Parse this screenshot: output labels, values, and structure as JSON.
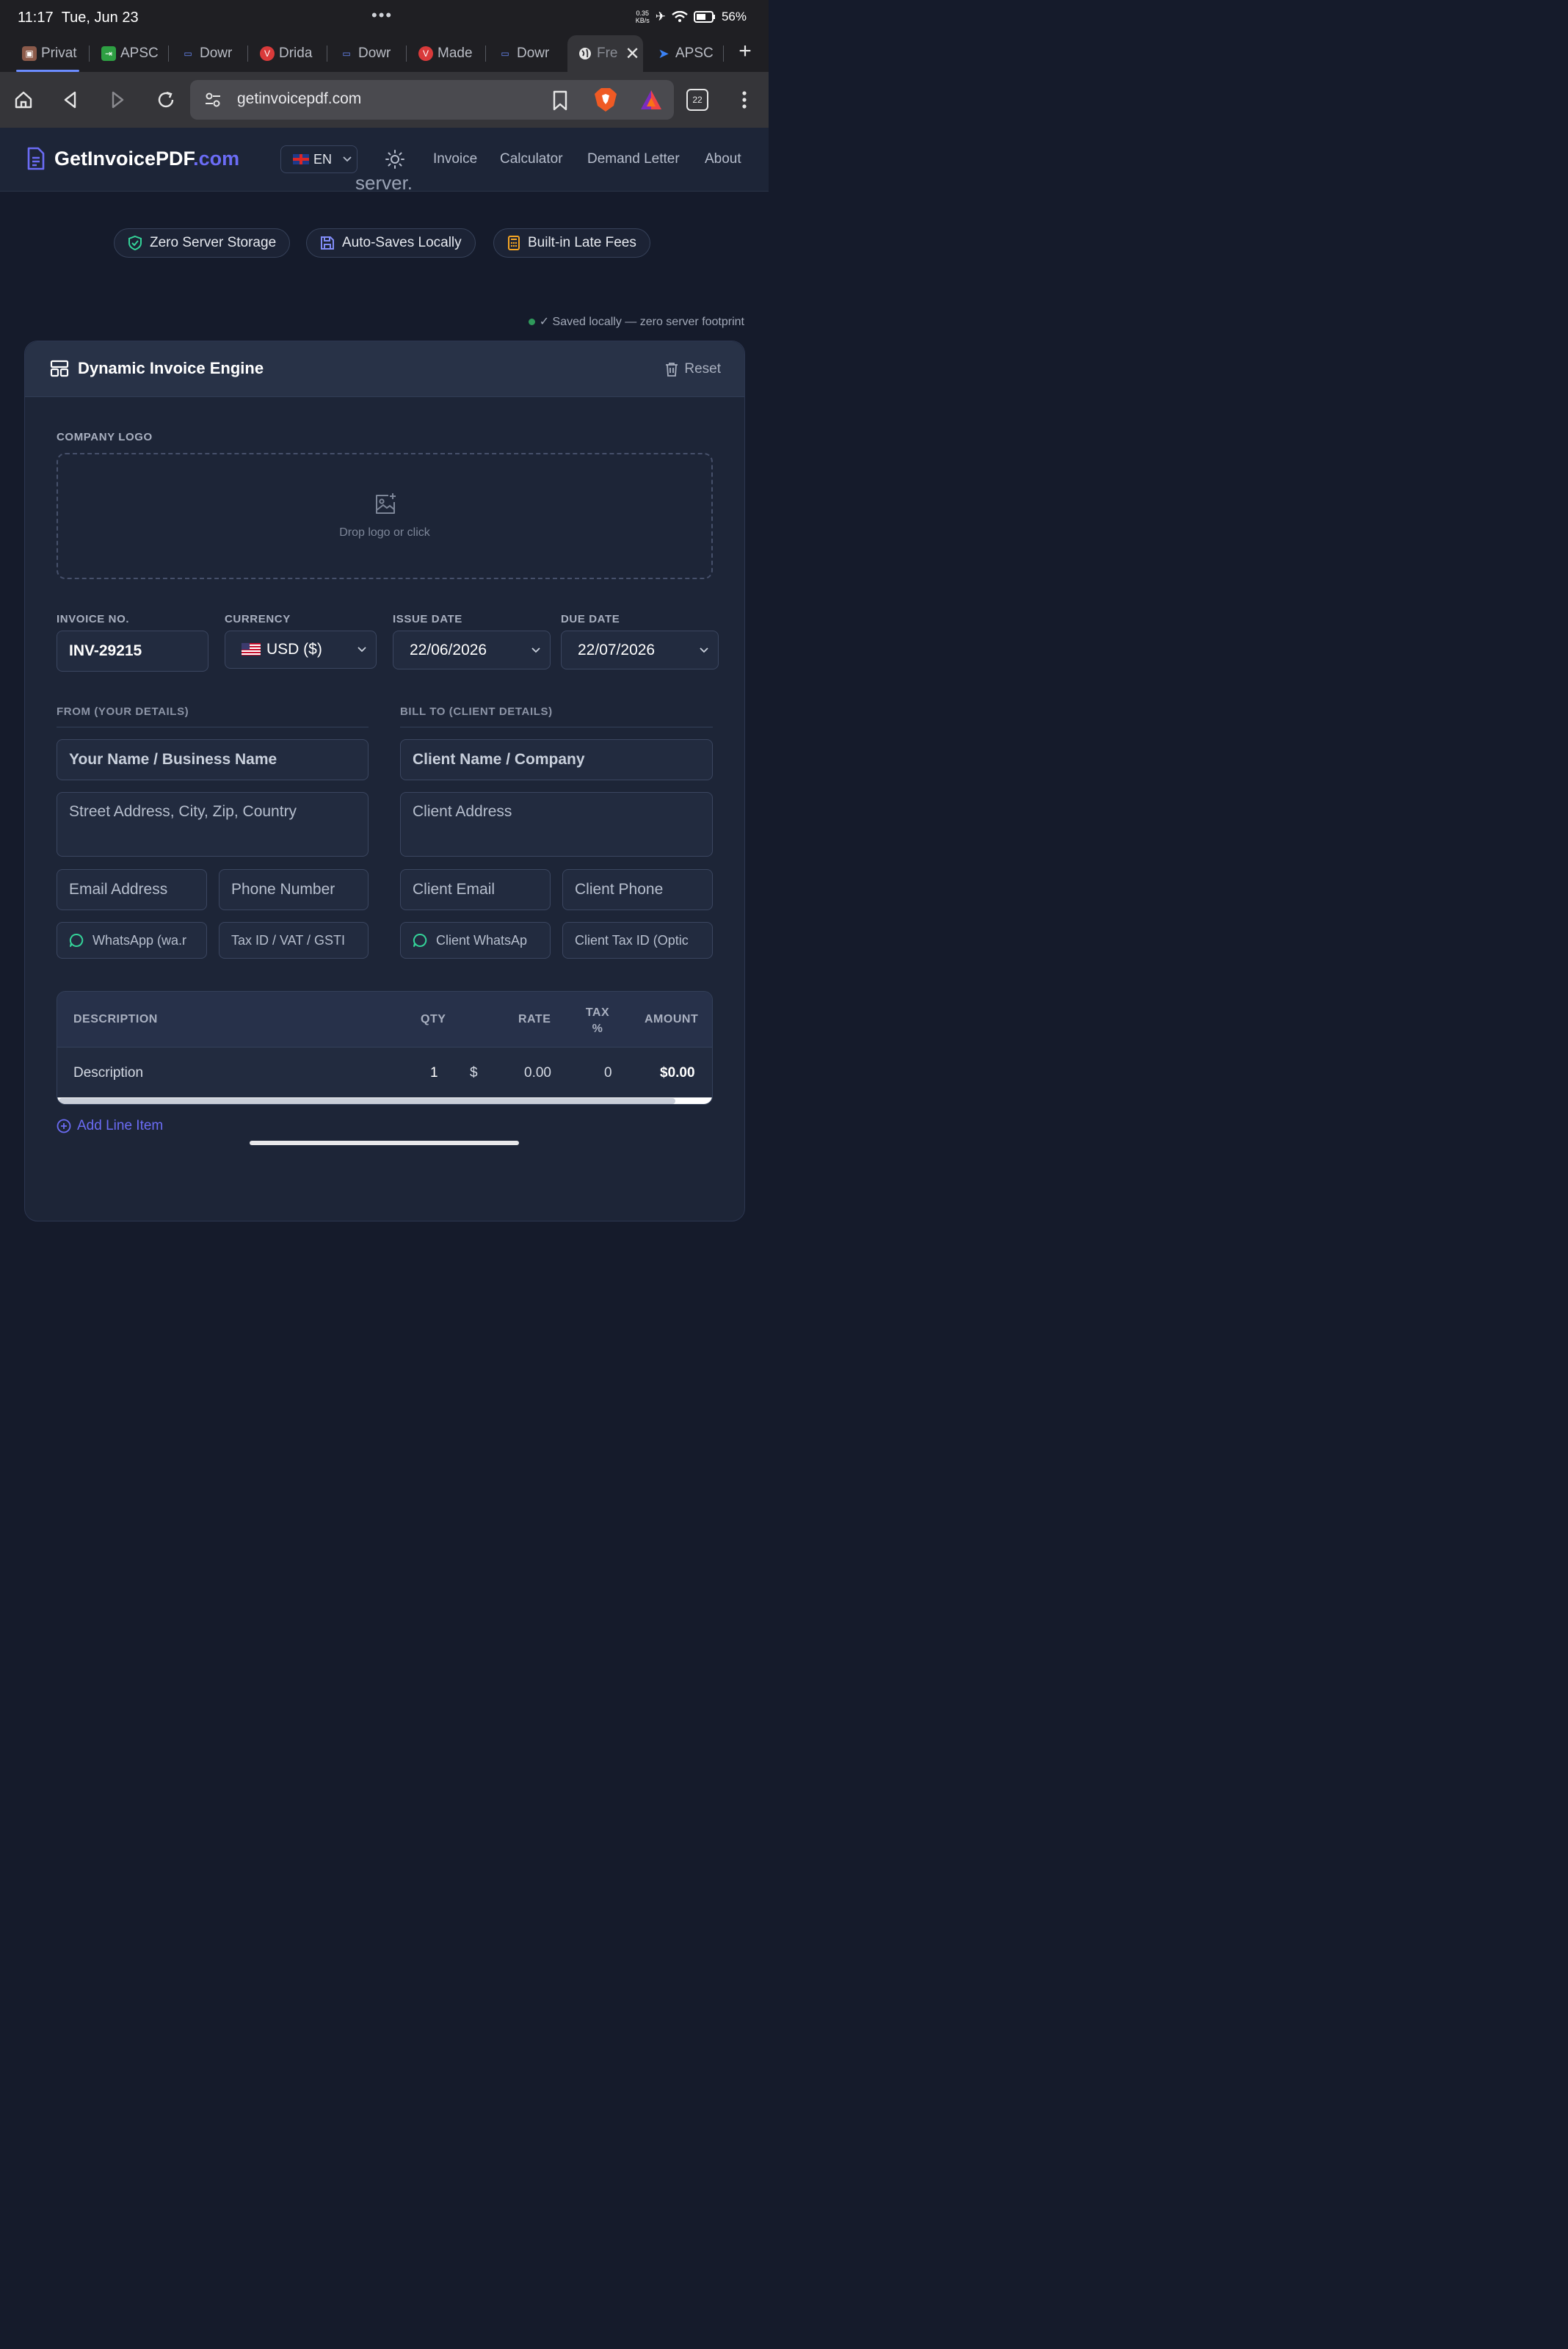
{
  "status": {
    "time": "11:17",
    "date": "Tue, Jun 23",
    "speed_value": "0.35",
    "speed_unit": "KB/s",
    "battery": "56%"
  },
  "tabs": [
    {
      "label": "Privat",
      "icon": "privacy-tab-icon",
      "color": "#8b5a4a"
    },
    {
      "label": "APSC",
      "icon": "apsc-tab-icon",
      "color": "#2ea043"
    },
    {
      "label": "Dowr",
      "icon": "download-tab-icon",
      "color": "#3b5bdb"
    },
    {
      "label": "Drida",
      "icon": "vivaldi-tab-icon",
      "color": "#d93a3a"
    },
    {
      "label": "Dowr",
      "icon": "download-tab-icon",
      "color": "#3b5bdb"
    },
    {
      "label": "Made",
      "icon": "vivaldi-tab-icon",
      "color": "#d93a3a"
    },
    {
      "label": "Dowr",
      "icon": "download-tab-icon",
      "color": "#3b5bdb"
    },
    {
      "label": "Fre",
      "icon": "globe-tab-icon",
      "color": "#e6e6e6"
    },
    {
      "label": "APSC",
      "icon": "apsc-tab-icon",
      "color": "#3b82f6"
    }
  ],
  "browser": {
    "url": "getinvoicepdf.com",
    "tab_count": "22"
  },
  "site": {
    "logo_main": "GetInvoicePDF",
    "logo_tld": ".com",
    "lang": "EN",
    "nav": [
      "Invoice",
      "Calculator",
      "Demand Letter",
      "About"
    ],
    "hero_cut": "server.",
    "chips": [
      "Zero Server Storage",
      "Auto-Saves Locally",
      "Built-in Late Fees"
    ],
    "saved_note": "✓ Saved locally — zero server footprint"
  },
  "card": {
    "title": "Dynamic Invoice Engine",
    "reset": "Reset",
    "logo_label": "COMPANY LOGO",
    "logo_drop": "Drop logo or click",
    "invoice_no_label": "INVOICE NO.",
    "invoice_no": "INV-29215",
    "currency_label": "CURRENCY",
    "currency": "USD ($)",
    "issue_label": "ISSUE DATE",
    "issue_date": "22/06/2026",
    "due_label": "DUE DATE",
    "due_date": "22/07/2026",
    "from_label": "FROM (YOUR DETAILS)",
    "billto_label": "BILL TO (CLIENT DETAILS)",
    "from": {
      "name": "Your Name / Business Name",
      "address": "Street Address, City, Zip, Country",
      "email": "Email Address",
      "phone": "Phone Number",
      "whatsapp": "WhatsApp (wa.r",
      "tax": "Tax ID / VAT / GSTI"
    },
    "client": {
      "name": "Client Name / Company",
      "address": "Client Address",
      "email": "Client Email",
      "phone": "Client Phone",
      "whatsapp": "Client WhatsAp",
      "tax": "Client Tax ID (Optic"
    },
    "table": {
      "headers": {
        "description": "DESCRIPTION",
        "qty": "QTY",
        "rate": "RATE",
        "tax_top": "TAX",
        "tax_bottom": "%",
        "amount": "AMOUNT"
      },
      "row": {
        "description": "Description",
        "qty": "1",
        "currency_symbol": "$",
        "rate": "0.00",
        "tax": "0",
        "amount": "$0.00"
      }
    },
    "add_line": "Add Line Item"
  }
}
